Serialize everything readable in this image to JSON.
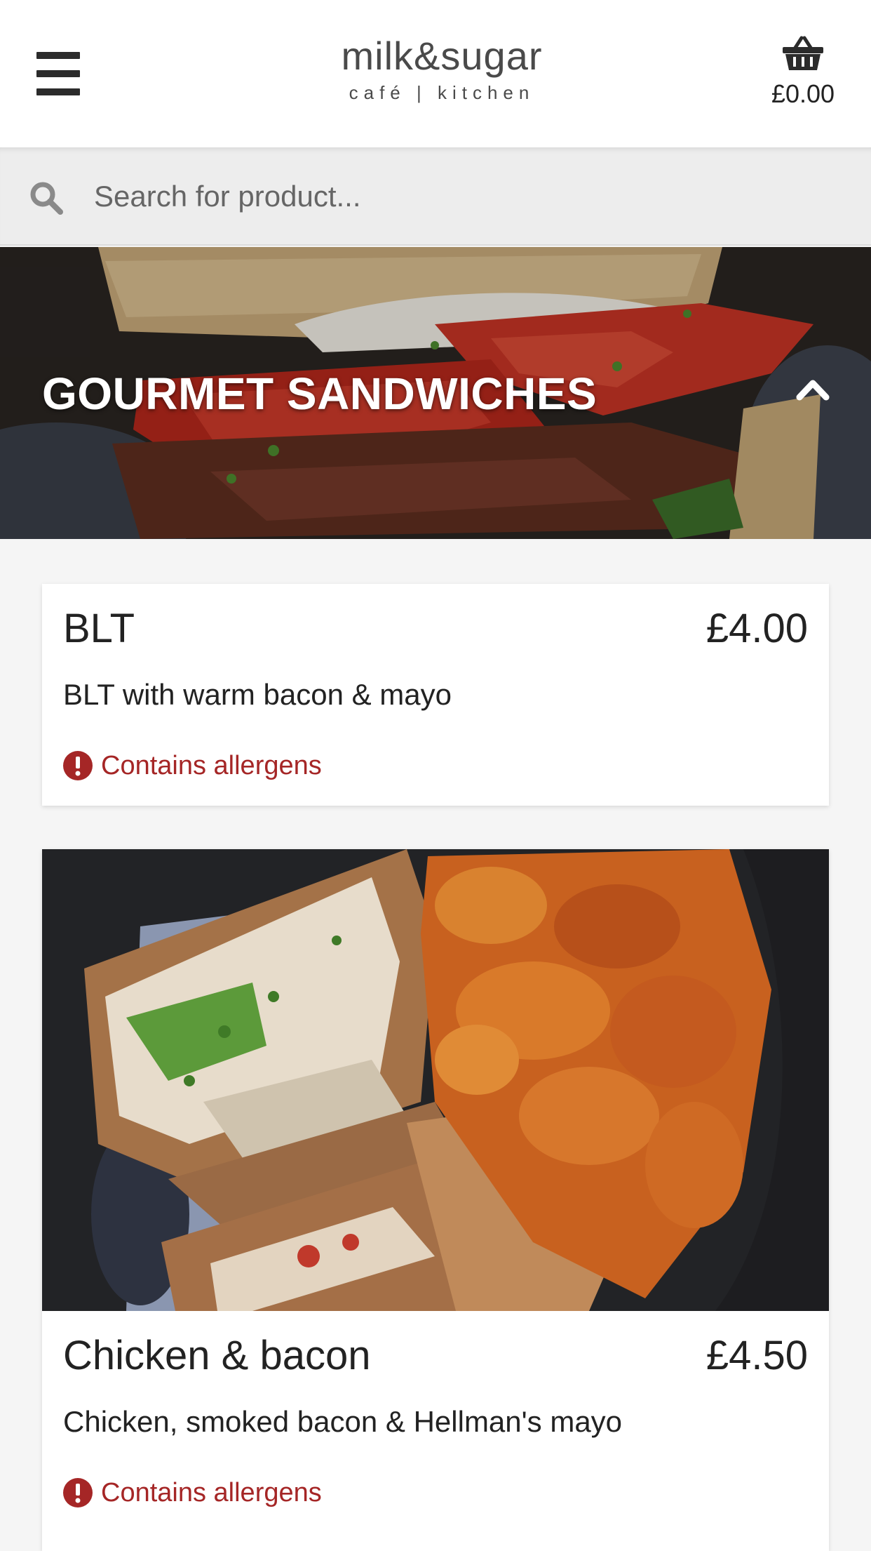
{
  "header": {
    "logo_main": "milk&sugar",
    "logo_sub": "café | kitchen",
    "basket_total": "£0.00",
    "menu_icon": "hamburger-menu-icon",
    "basket_icon": "shopping-basket-icon"
  },
  "search": {
    "placeholder": "Search for product...",
    "value": "",
    "icon": "search-icon"
  },
  "category": {
    "title": "GOURMET SANDWICHES",
    "collapse_icon": "chevron-up-icon",
    "expanded": true
  },
  "products": [
    {
      "name": "BLT",
      "price": "£4.00",
      "description": "BLT with warm bacon & mayo",
      "allergen_label": "Contains allergens",
      "has_photo": false
    },
    {
      "name": "Chicken & bacon",
      "price": "£4.50",
      "description": "Chicken, smoked bacon & Hellman's mayo",
      "allergen_label": "Contains allergens",
      "has_photo": true
    }
  ],
  "colors": {
    "header_bg": "#ffffff",
    "search_bg": "#ededed",
    "page_bg": "#f5f5f5",
    "allergen": "#a52626",
    "text": "#222222"
  }
}
